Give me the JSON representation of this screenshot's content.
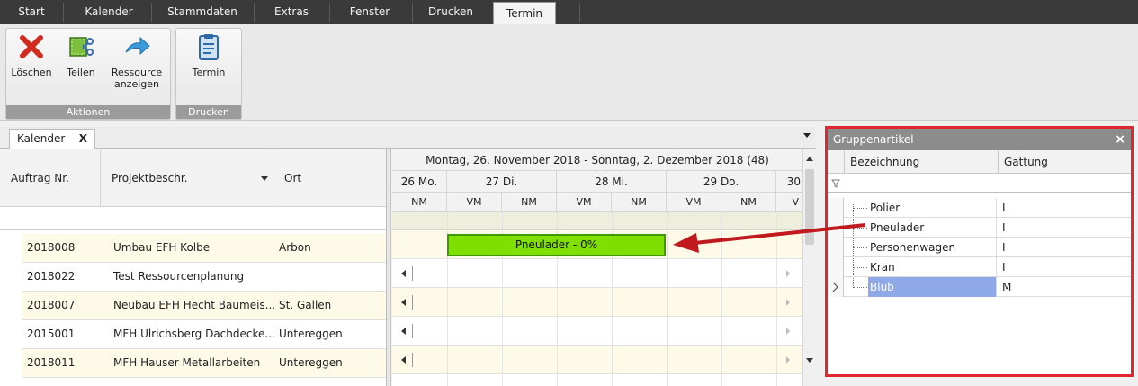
{
  "menu": {
    "tabs": [
      "Start",
      "Kalender",
      "Stammdaten",
      "Extras",
      "Fenster",
      "Drucken",
      "Termin"
    ],
    "active": "Termin"
  },
  "ribbon": {
    "groups": [
      {
        "label": "Aktionen",
        "buttons": [
          {
            "label": "Löschen",
            "icon": "delete-x-icon"
          },
          {
            "label": "Teilen",
            "icon": "split-icon"
          },
          {
            "label": "Ressource anzeigen",
            "icon": "arrow-right-icon"
          }
        ]
      },
      {
        "label": "Drucken",
        "buttons": [
          {
            "label": "Termin",
            "icon": "clipboard-icon"
          }
        ]
      }
    ]
  },
  "doc_tab": {
    "label": "Kalender",
    "close": "X"
  },
  "grid": {
    "columns": [
      "Auftrag Nr.",
      "Projektbeschr.",
      "Ort"
    ],
    "rows": [
      {
        "nr": "2018008",
        "desc": "Umbau EFH Kolbe",
        "ort": "Arbon"
      },
      {
        "nr": "2018022",
        "desc": "Test Ressourcenplanung",
        "ort": ""
      },
      {
        "nr": "2018007",
        "desc": "Neubau EFH Hecht Baumeis...",
        "ort": "St. Gallen"
      },
      {
        "nr": "2015001",
        "desc": "MFH Ulrichsberg Dachdecke...",
        "ort": "Untereggen"
      },
      {
        "nr": "2018011",
        "desc": "MFH Hauser Metallarbeiten",
        "ort": "Untereggen"
      }
    ]
  },
  "scheduler": {
    "range": "Montag, 26. November 2018 - Sonntag, 2. Dezember 2018 (48)",
    "days": [
      "26 Mo.",
      "27 Di.",
      "28 Mi.",
      "29 Do.",
      "30"
    ],
    "halves": [
      "NM",
      "VM",
      "NM",
      "VM",
      "NM",
      "VM",
      "NM",
      "V"
    ],
    "appointment": "Pneulader - 0%"
  },
  "panel": {
    "title": "Gruppenartikel",
    "close": "×",
    "columns": [
      "Bezeichnung",
      "Gattung"
    ],
    "items": [
      {
        "name": "Polier",
        "gattung": "L"
      },
      {
        "name": "Pneulader",
        "gattung": "I"
      },
      {
        "name": "Personenwagen",
        "gattung": "I"
      },
      {
        "name": "Kran",
        "gattung": "I"
      },
      {
        "name": "Blub",
        "gattung": "M"
      }
    ],
    "selected": "Blub",
    "accent": "#e0262e"
  },
  "colors": {
    "appointment_fill": "#7fe000",
    "arrow": "#c0191e",
    "selection": "#8fa8e8"
  }
}
